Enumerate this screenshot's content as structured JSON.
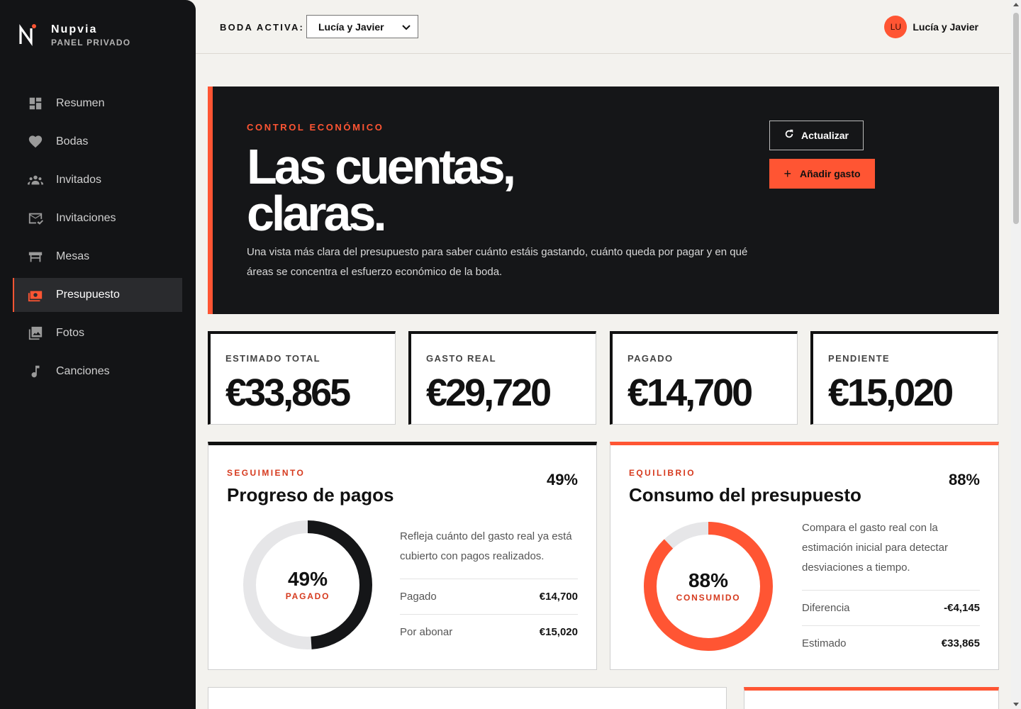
{
  "sidebar": {
    "brand_name": "Nupvia",
    "brand_sub": "PANEL PRIVADO",
    "items": [
      {
        "label": "Resumen",
        "icon": "dashboard-icon"
      },
      {
        "label": "Bodas",
        "icon": "heart-icon"
      },
      {
        "label": "Invitados",
        "icon": "people-icon"
      },
      {
        "label": "Invitaciones",
        "icon": "mail-check-icon"
      },
      {
        "label": "Mesas",
        "icon": "table-icon"
      },
      {
        "label": "Presupuesto",
        "icon": "money-icon",
        "active": true
      },
      {
        "label": "Fotos",
        "icon": "photos-icon"
      },
      {
        "label": "Canciones",
        "icon": "music-note-icon"
      }
    ]
  },
  "topbar": {
    "wedding_label": "BODA ACTIVA:",
    "wedding_selected": "Lucía y Javier",
    "user_initials": "LU",
    "user_name": "Lucía y Javier"
  },
  "hero": {
    "eyebrow": "CONTROL ECONÓMICO",
    "title_line1": "Las cuentas,",
    "title_line2": "claras.",
    "description": "Una vista más clara del presupuesto para saber cuánto estáis gastando, cuánto queda por pagar y en qué áreas se concentra el esfuerzo económico de la boda.",
    "refresh_label": "Actualizar",
    "add_label": "Añadir gasto"
  },
  "kpis": [
    {
      "label": "ESTIMADO TOTAL",
      "value": "€33,865"
    },
    {
      "label": "GASTO REAL",
      "value": "€29,720"
    },
    {
      "label": "PAGADO",
      "value": "€14,700"
    },
    {
      "label": "PENDIENTE",
      "value": "€15,020"
    }
  ],
  "payments": {
    "eyebrow": "SEGUIMIENTO",
    "title": "Progreso de pagos",
    "percent": "49%",
    "fraction": 0.49,
    "center_value": "49%",
    "center_label": "PAGADO",
    "description": "Refleja cuánto del gasto real ya está cubierto con pagos realizados.",
    "rows": [
      {
        "label": "Pagado",
        "value": "€14,700"
      },
      {
        "label": "Por abonar",
        "value": "€15,020"
      }
    ]
  },
  "consumption": {
    "eyebrow": "EQUILIBRIO",
    "title": "Consumo del presupuesto",
    "percent": "88%",
    "fraction": 0.88,
    "center_value": "88%",
    "center_label": "CONSUMIDO",
    "description": "Compara el gasto real con la estimación inicial para detectar desviaciones a tiempo.",
    "rows": [
      {
        "label": "Diferencia",
        "value": "-€4,145"
      },
      {
        "label": "Estimado",
        "value": "€33,865"
      }
    ]
  },
  "colors": {
    "accent": "#ff5533",
    "dark": "#151618",
    "ring_track": "#e6e6e8"
  }
}
